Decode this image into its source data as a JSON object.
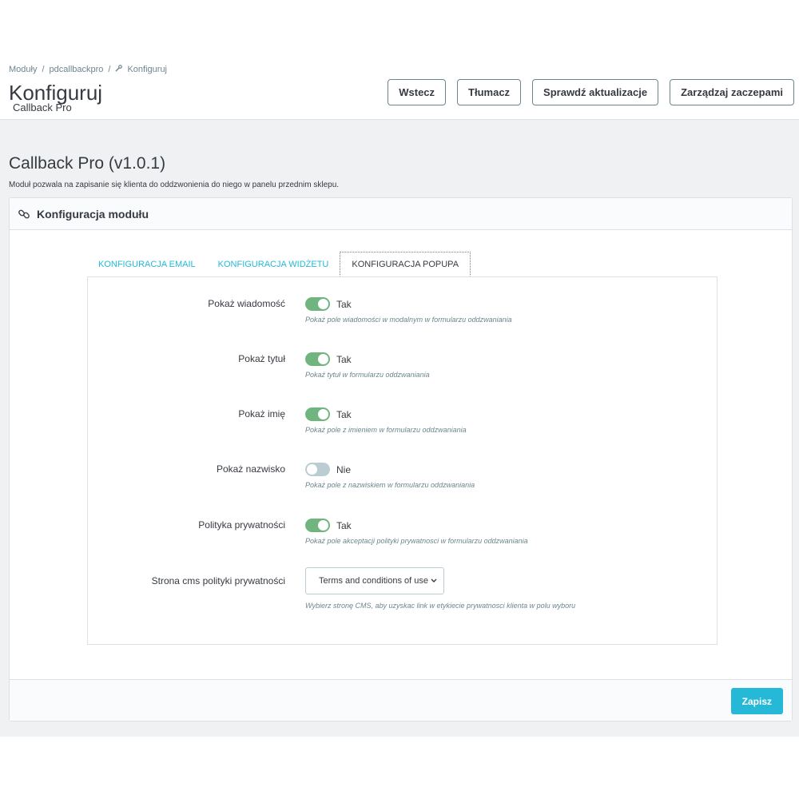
{
  "breadcrumb": {
    "items": [
      "Moduły",
      "pdcallbackpro",
      "Konfiguruj"
    ],
    "separator": "/"
  },
  "header": {
    "title": "Konfiguruj",
    "subtitle": "Callback Pro"
  },
  "toolbar": {
    "back_label": "Wstecz",
    "translate_label": "Tłumacz",
    "check_updates_label": "Sprawdź aktualizacje",
    "manage_hooks_label": "Zarządzaj zaczepami"
  },
  "module": {
    "title": "Callback Pro (v1.0.1)",
    "description": "Moduł pozwala na zapisanie się klienta do oddzwonienia do niego w panelu przednim sklepu."
  },
  "panel": {
    "title": "Konfiguracja modułu",
    "icon": "link-icon"
  },
  "tabs": [
    {
      "label": "KONFIGURACJA EMAIL",
      "active": false
    },
    {
      "label": "KONFIGURACJA WIDŻETU",
      "active": false
    },
    {
      "label": "KONFIGURACJA POPUPA",
      "active": true
    }
  ],
  "form": {
    "fields": [
      {
        "label": "Pokaż wiadomość",
        "state": "on",
        "value_text": "Tak",
        "help": "Pokaż pole wiadomości w modalnym w formularzu oddzwaniania"
      },
      {
        "label": "Pokaż tytuł",
        "state": "on",
        "value_text": "Tak",
        "help": "Pokaż tytuł w formularzu oddzwaniania"
      },
      {
        "label": "Pokaż imię",
        "state": "on",
        "value_text": "Tak",
        "help": "Pokaż pole z imieniem w formularzu oddzwaniania"
      },
      {
        "label": "Pokaż nazwisko",
        "state": "off",
        "value_text": "Nie",
        "help": "Pokaż pole z nazwiskiem w formularzu oddzwaniania"
      },
      {
        "label": "Polityka prywatności",
        "state": "on",
        "value_text": "Tak",
        "help": "Pokaż pole akceptacji polityki prywatnosci w formularzu oddzwaniania"
      }
    ],
    "cms_select": {
      "label": "Strona cms polityki prywatności",
      "selected": "Terms and conditions of use",
      "help": "Wybierz stronę CMS, aby uzyskac link w etykiecie prywatnosci klienta w polu wyboru"
    }
  },
  "footer": {
    "save_label": "Zapisz"
  },
  "colors": {
    "accent": "#25b9d7",
    "switch_on": "#70b580",
    "switch_off": "#bbcdd2",
    "background": "#eff1f2"
  }
}
